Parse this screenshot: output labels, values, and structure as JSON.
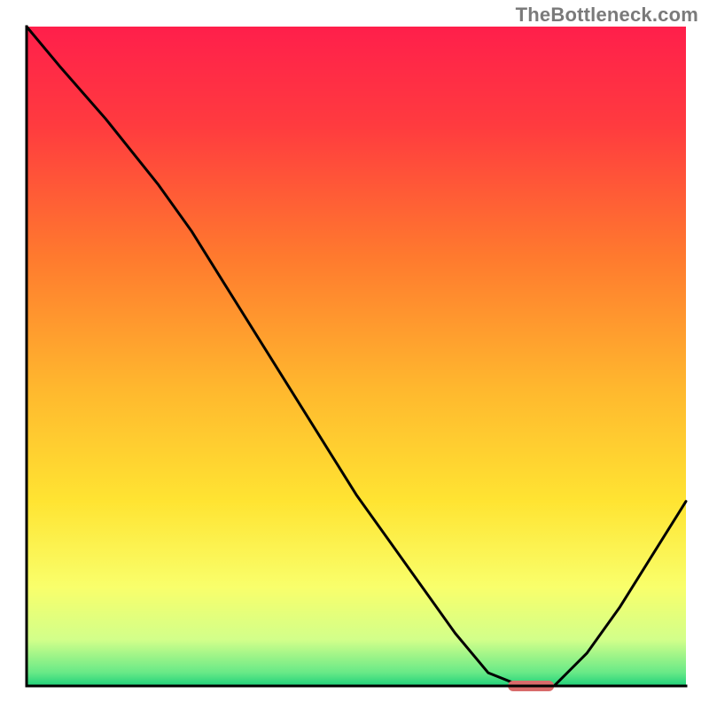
{
  "watermark": "TheBottleneck.com",
  "chart_data": {
    "type": "line",
    "title": "",
    "xlabel": "",
    "ylabel": "",
    "xlim": [
      0,
      100
    ],
    "ylim": [
      0,
      100
    ],
    "grid": false,
    "series": [
      {
        "name": "curve",
        "x": [
          0,
          5,
          12,
          20,
          25,
          30,
          35,
          40,
          45,
          50,
          55,
          60,
          65,
          70,
          75,
          80,
          85,
          90,
          95,
          100
        ],
        "values": [
          100,
          94,
          86,
          76,
          69,
          61,
          53,
          45,
          37,
          29,
          22,
          15,
          8,
          2,
          0,
          0,
          5,
          12,
          20,
          28
        ]
      }
    ],
    "marker": {
      "x_start": 73,
      "x_end": 80,
      "y": 0
    },
    "annotations": [],
    "legend": null,
    "gradient_stops": [
      {
        "offset": 0.0,
        "color": "#ff1f4b"
      },
      {
        "offset": 0.15,
        "color": "#ff3b3f"
      },
      {
        "offset": 0.35,
        "color": "#ff7a2e"
      },
      {
        "offset": 0.55,
        "color": "#ffb82e"
      },
      {
        "offset": 0.72,
        "color": "#ffe432"
      },
      {
        "offset": 0.85,
        "color": "#f9ff6b"
      },
      {
        "offset": 0.93,
        "color": "#d2ff8a"
      },
      {
        "offset": 0.98,
        "color": "#67e987"
      },
      {
        "offset": 1.0,
        "color": "#1fd07a"
      }
    ]
  },
  "plot_geometry": {
    "outer_w": 800,
    "outer_h": 800,
    "inner_x": 30,
    "inner_y": 30,
    "inner_w": 744,
    "inner_h": 744,
    "axis_stroke": "#000000",
    "axis_stroke_width": 3,
    "curve_stroke": "#000000",
    "curve_stroke_width": 3,
    "marker_fill": "#d86b6b",
    "marker_height": 12,
    "marker_rx": 6
  }
}
